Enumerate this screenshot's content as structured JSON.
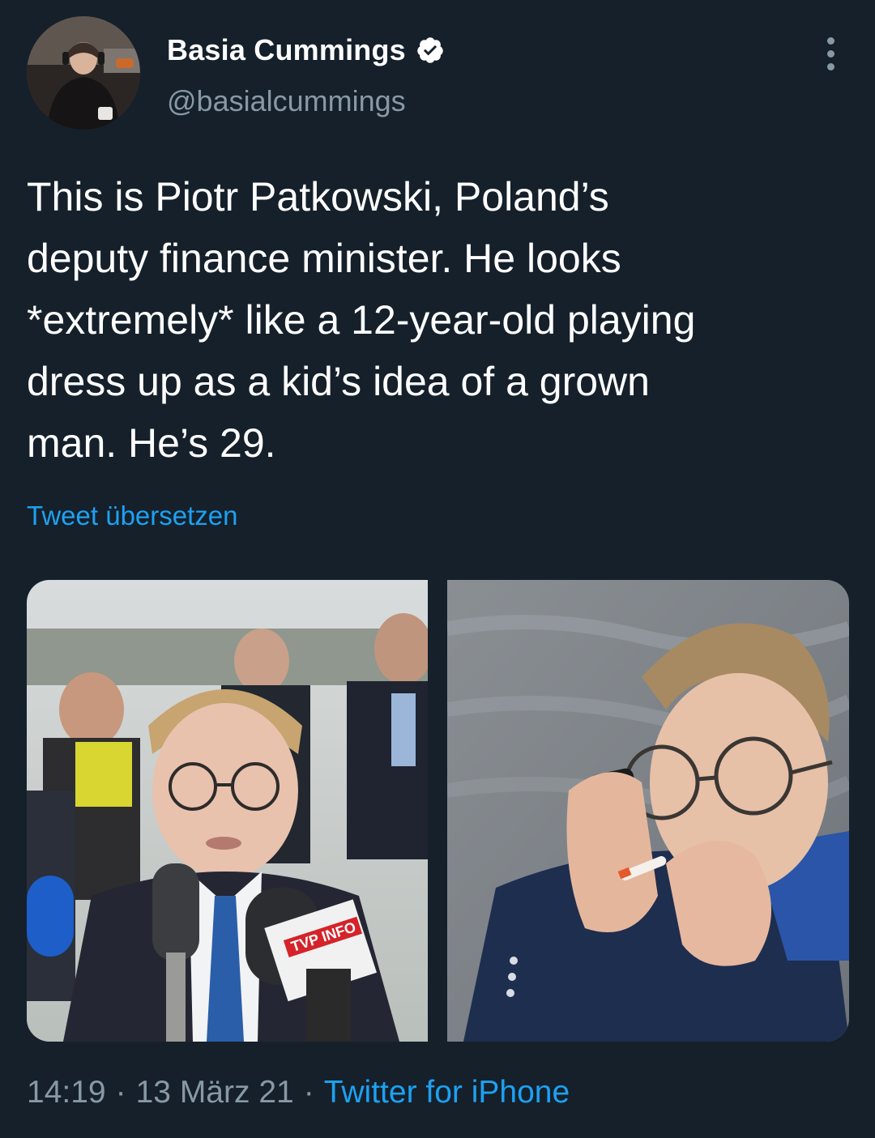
{
  "author": {
    "display_name": "Basia Cummings",
    "handle": "@basialcummings",
    "verified": true,
    "avatar_icon": "profile-photo"
  },
  "tweet": {
    "text": "This is Piotr Patkowski, Poland’s\ndeputy finance minister. He looks\n*extremely* like a 12-year-old playing\ndress up as a kid’s idea of a grown\nman. He’s 29.",
    "translate_label": "Tweet übersetzen"
  },
  "media": {
    "photo_count": 2,
    "left_mic_label": "TVP INFO"
  },
  "footer": {
    "time": "14:19",
    "separator": "·",
    "date": "13 März 21",
    "source": "Twitter for iPhone"
  },
  "colors": {
    "background": "#15202b",
    "text_primary": "#ffffff",
    "text_secondary": "#8899a6",
    "accent": "#1da1f2"
  }
}
